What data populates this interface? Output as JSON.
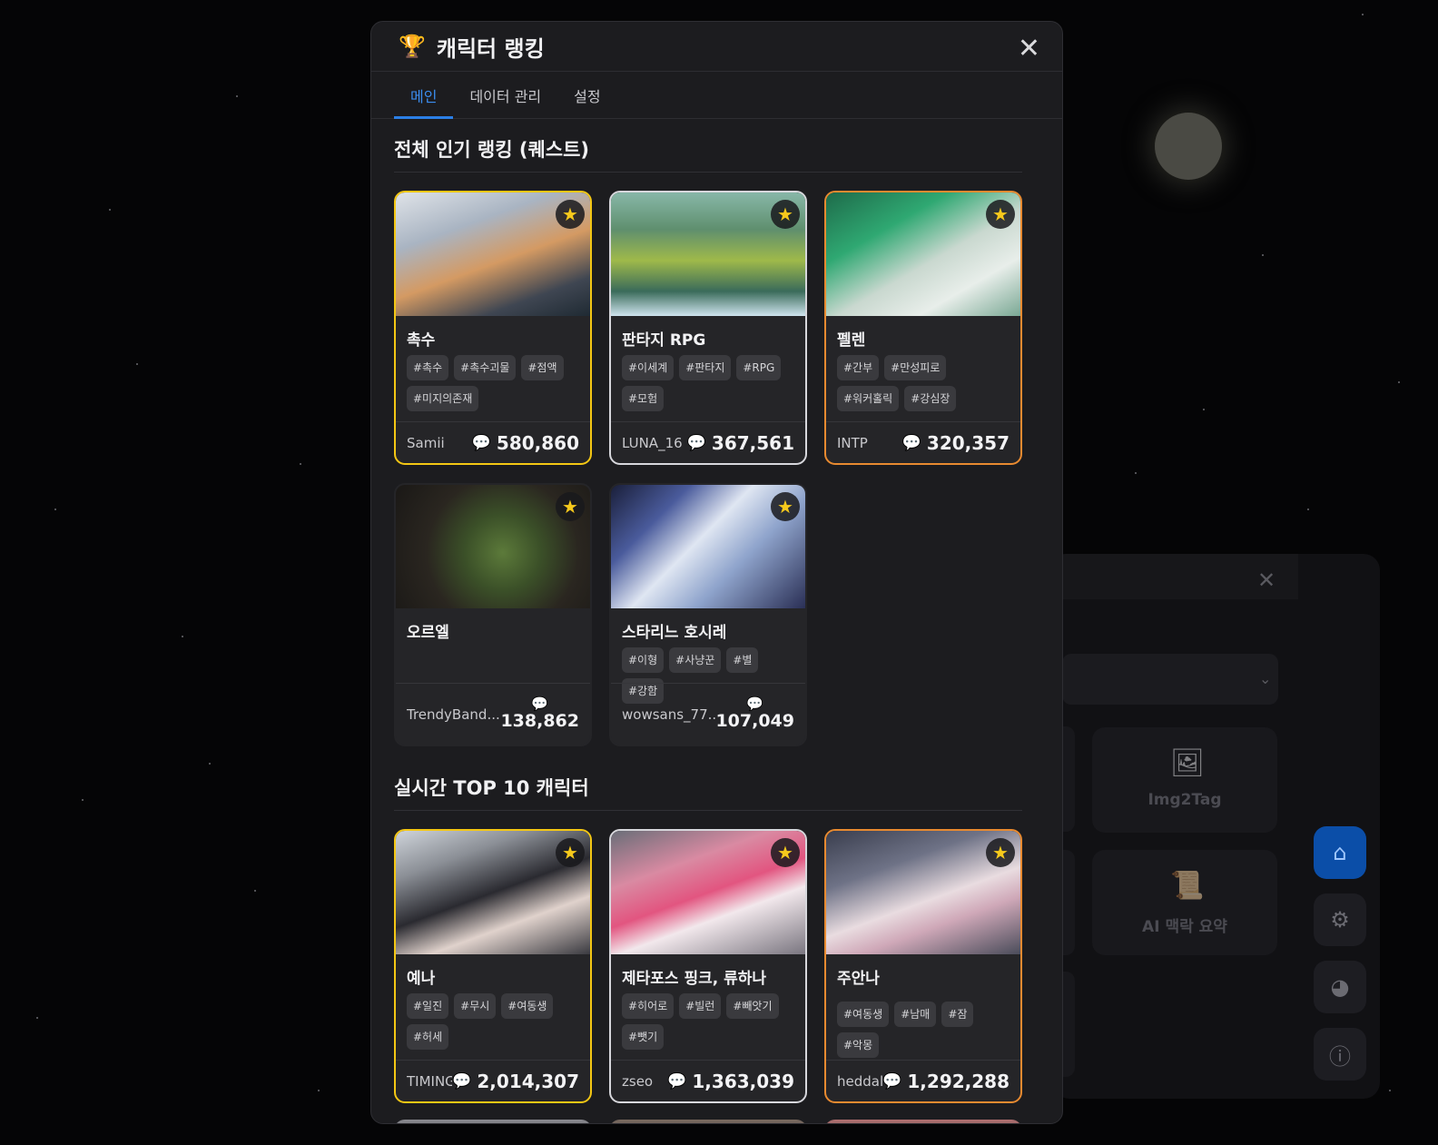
{
  "modal": {
    "title": "캐릭터 랭킹",
    "tabs": [
      {
        "label": "메인",
        "active": true
      },
      {
        "label": "데이터 관리",
        "active": false
      },
      {
        "label": "설정",
        "active": false
      }
    ]
  },
  "sections": [
    {
      "title": "전체 인기 랭킹 (퀘스트)",
      "cards": [
        {
          "name": "촉수",
          "tags": [
            "#촉수",
            "#촉수괴물",
            "#점액",
            "#미지의존재"
          ],
          "author": "Samii",
          "count": "580,860"
        },
        {
          "name": "판타지 RPG",
          "tags": [
            "#이세계",
            "#판타지",
            "#RPG",
            "#모험"
          ],
          "author": "LUNA_16",
          "count": "367,561"
        },
        {
          "name": "펠렌",
          "tags": [
            "#간부",
            "#만성피로",
            "#워커홀릭",
            "#강심장"
          ],
          "author": "INTP",
          "count": "320,357"
        },
        {
          "name": "오르엘",
          "tags": [],
          "author": "TrendyBand...",
          "count": "138,862"
        },
        {
          "name": "스타리느 호시레",
          "tags": [
            "#이형",
            "#사냥꾼",
            "#별",
            "#강함"
          ],
          "author": "wowsans_77...",
          "count": "107,049"
        }
      ]
    },
    {
      "title": "실시간 TOP 10 캐릭터",
      "cards": [
        {
          "name": "예나",
          "tags": [
            "#일진",
            "#무시",
            "#여동생",
            "#허세"
          ],
          "author": "TIMING_",
          "count": "2,014,307"
        },
        {
          "name": "제타포스 핑크, 류하나",
          "tags": [
            "#히어로",
            "#빌런",
            "#빼앗기",
            "#뺏기"
          ],
          "author": "zseo",
          "count": "1,363,039"
        },
        {
          "name": "주안나",
          "tags": [
            "#여동생",
            "#남매",
            "#잠",
            "#악몽"
          ],
          "author": "heddal",
          "count": "1,292,288"
        }
      ]
    }
  ],
  "background": {
    "cards": [
      {
        "label": "Img2Tag",
        "icon": "image-icon"
      },
      {
        "label": "AI 맥락 요약",
        "icon": "scroll-icon"
      }
    ]
  },
  "colors": {
    "accent": "#2b7fe6",
    "gold": "#f4c714",
    "silver": "#d7d7dc",
    "bronze": "#e88a30"
  }
}
